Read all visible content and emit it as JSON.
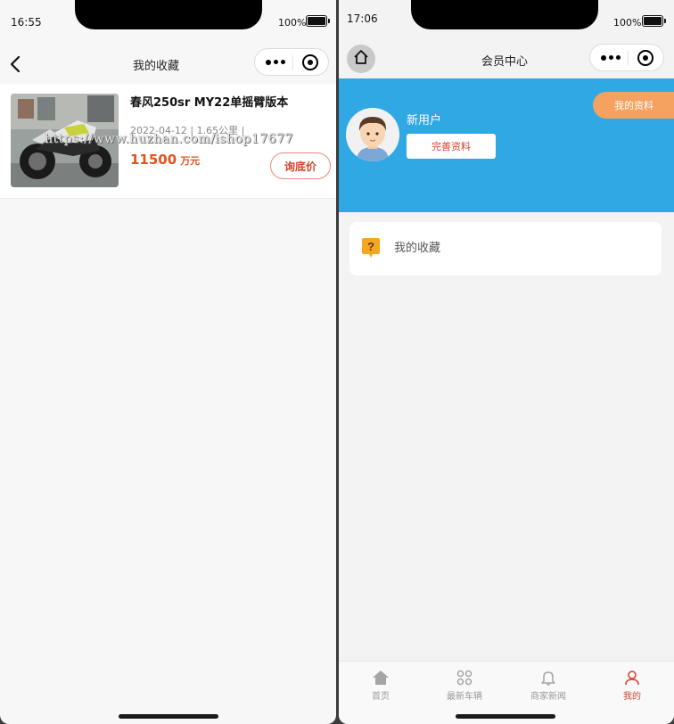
{
  "left_screen": {
    "status": {
      "time": "16:55",
      "battery": "100%"
    },
    "nav": {
      "title": "我的收藏"
    },
    "favorite_item": {
      "title": "春风250sr MY22单摇臂版本",
      "meta": "2022-04-12 | 1.65公里 |",
      "price": "11500",
      "price_unit": "万元",
      "inquire_label": "询底价",
      "watermark": "https://www.huzhan.com/ishop17677"
    }
  },
  "right_screen": {
    "status": {
      "time": "17:06",
      "battery": "100%"
    },
    "nav": {
      "title": "会员中心"
    },
    "profile": {
      "username": "新用户",
      "complete_label": "完善资料",
      "profile_tag": "我的资料"
    },
    "menu": [
      {
        "label": "我的收藏",
        "icon": "question-icon"
      }
    ],
    "tabbar": [
      {
        "label": "首页",
        "icon": "home-icon"
      },
      {
        "label": "最新车辆",
        "icon": "grid-icon"
      },
      {
        "label": "商家新闻",
        "icon": "bell-icon"
      },
      {
        "label": "我的",
        "icon": "person-icon",
        "active": true
      }
    ]
  },
  "colors": {
    "accent_red": "#d2442c",
    "price_orange": "#e0531f",
    "header_blue": "#2fa8e4",
    "tag_orange": "#f5a15f"
  }
}
